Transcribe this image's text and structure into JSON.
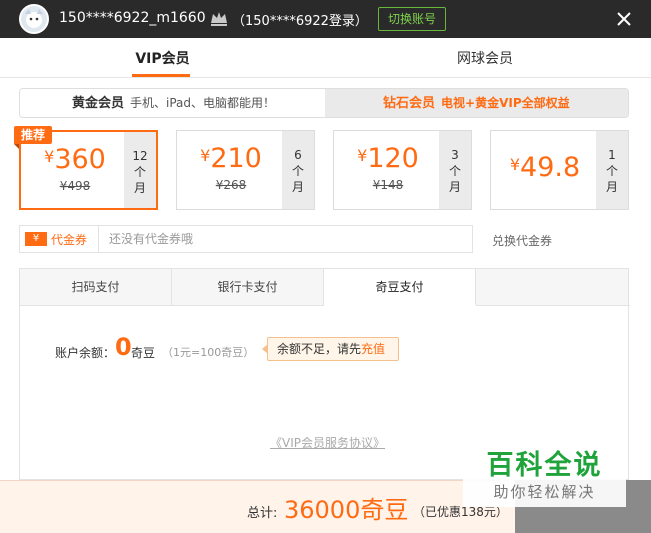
{
  "header": {
    "username": "150****6922_m1660",
    "login_hint": "（150****6922登录）",
    "switch_account": "切换账号"
  },
  "tabs": [
    "VIP会员",
    "网球会员"
  ],
  "member_types": [
    {
      "title": "黄金会员",
      "desc": "手机、iPad、电脑都能用！"
    },
    {
      "title": "钻石会员",
      "desc": "电视+黄金VIP全部权益"
    }
  ],
  "packages": [
    {
      "price": "360",
      "original": "¥498",
      "duration": [
        "12",
        "个",
        "月"
      ],
      "badge": "推荐",
      "selected": true
    },
    {
      "price": "210",
      "original": "¥268",
      "duration": [
        "6",
        "个",
        "月"
      ],
      "selected": false
    },
    {
      "price": "120",
      "original": "¥148",
      "duration": [
        "3",
        "个",
        "月"
      ],
      "selected": false
    },
    {
      "price": "49.8",
      "original": "",
      "duration": [
        "1",
        "个",
        "月"
      ],
      "selected": false
    }
  ],
  "currency_symbol": "¥",
  "coupon": {
    "icon_text": "¥",
    "label": "代金券",
    "placeholder": "还没有代金券哦",
    "redeem": "兑换代金券"
  },
  "payment": {
    "methods": [
      "扫码支付",
      "银行卡支付",
      "奇豆支付"
    ],
    "active": "奇豆支付",
    "balance_label": "账户余额：",
    "balance_value": "0",
    "balance_unit": "奇豆",
    "rate": "（1元=100奇豆）",
    "tip_text": "余额不足，请先",
    "tip_action": "充值",
    "agreement": "《VIP会员服务协议》"
  },
  "footer": {
    "total_label": "总计:",
    "total_value": "36000奇豆",
    "saving": "（已优惠138元）"
  },
  "watermark": {
    "line1": "百科全说",
    "line2": "助你轻松解决"
  },
  "colors": {
    "accent": "#ff6b13",
    "header_bg": "#2a2a2a",
    "switch_green": "#7ed14e",
    "watermark_green": "#1fa33a"
  }
}
